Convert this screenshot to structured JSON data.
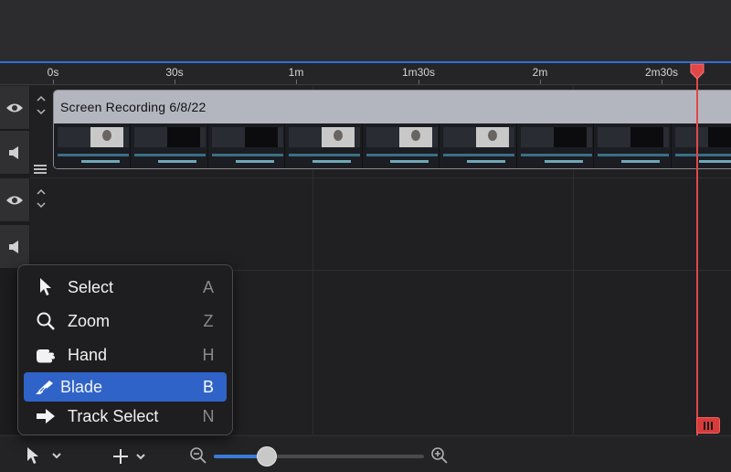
{
  "ruler": {
    "ticks": [
      "0s",
      "30s",
      "1m",
      "1m30s",
      "2m",
      "2m30s"
    ]
  },
  "clip": {
    "title": "Screen Recording 6/8/22"
  },
  "tool_menu": {
    "items": [
      {
        "label": "Select",
        "shortcut": "A",
        "icon": "arrow-pointer-icon",
        "selected": false
      },
      {
        "label": "Zoom",
        "shortcut": "Z",
        "icon": "magnifier-icon",
        "selected": false
      },
      {
        "label": "Hand",
        "shortcut": "H",
        "icon": "hand-icon",
        "selected": false
      },
      {
        "label": "Blade",
        "shortcut": "B",
        "icon": "blade-icon",
        "selected": true
      },
      {
        "label": "Track Select",
        "shortcut": "N",
        "icon": "arrow-right-icon",
        "selected": false
      }
    ]
  },
  "timeline_zoom": {
    "level": 0.25
  },
  "colors": {
    "accent": "#2f63c8",
    "playhead": "#e04848",
    "clip_header": "#b4b6bf"
  }
}
